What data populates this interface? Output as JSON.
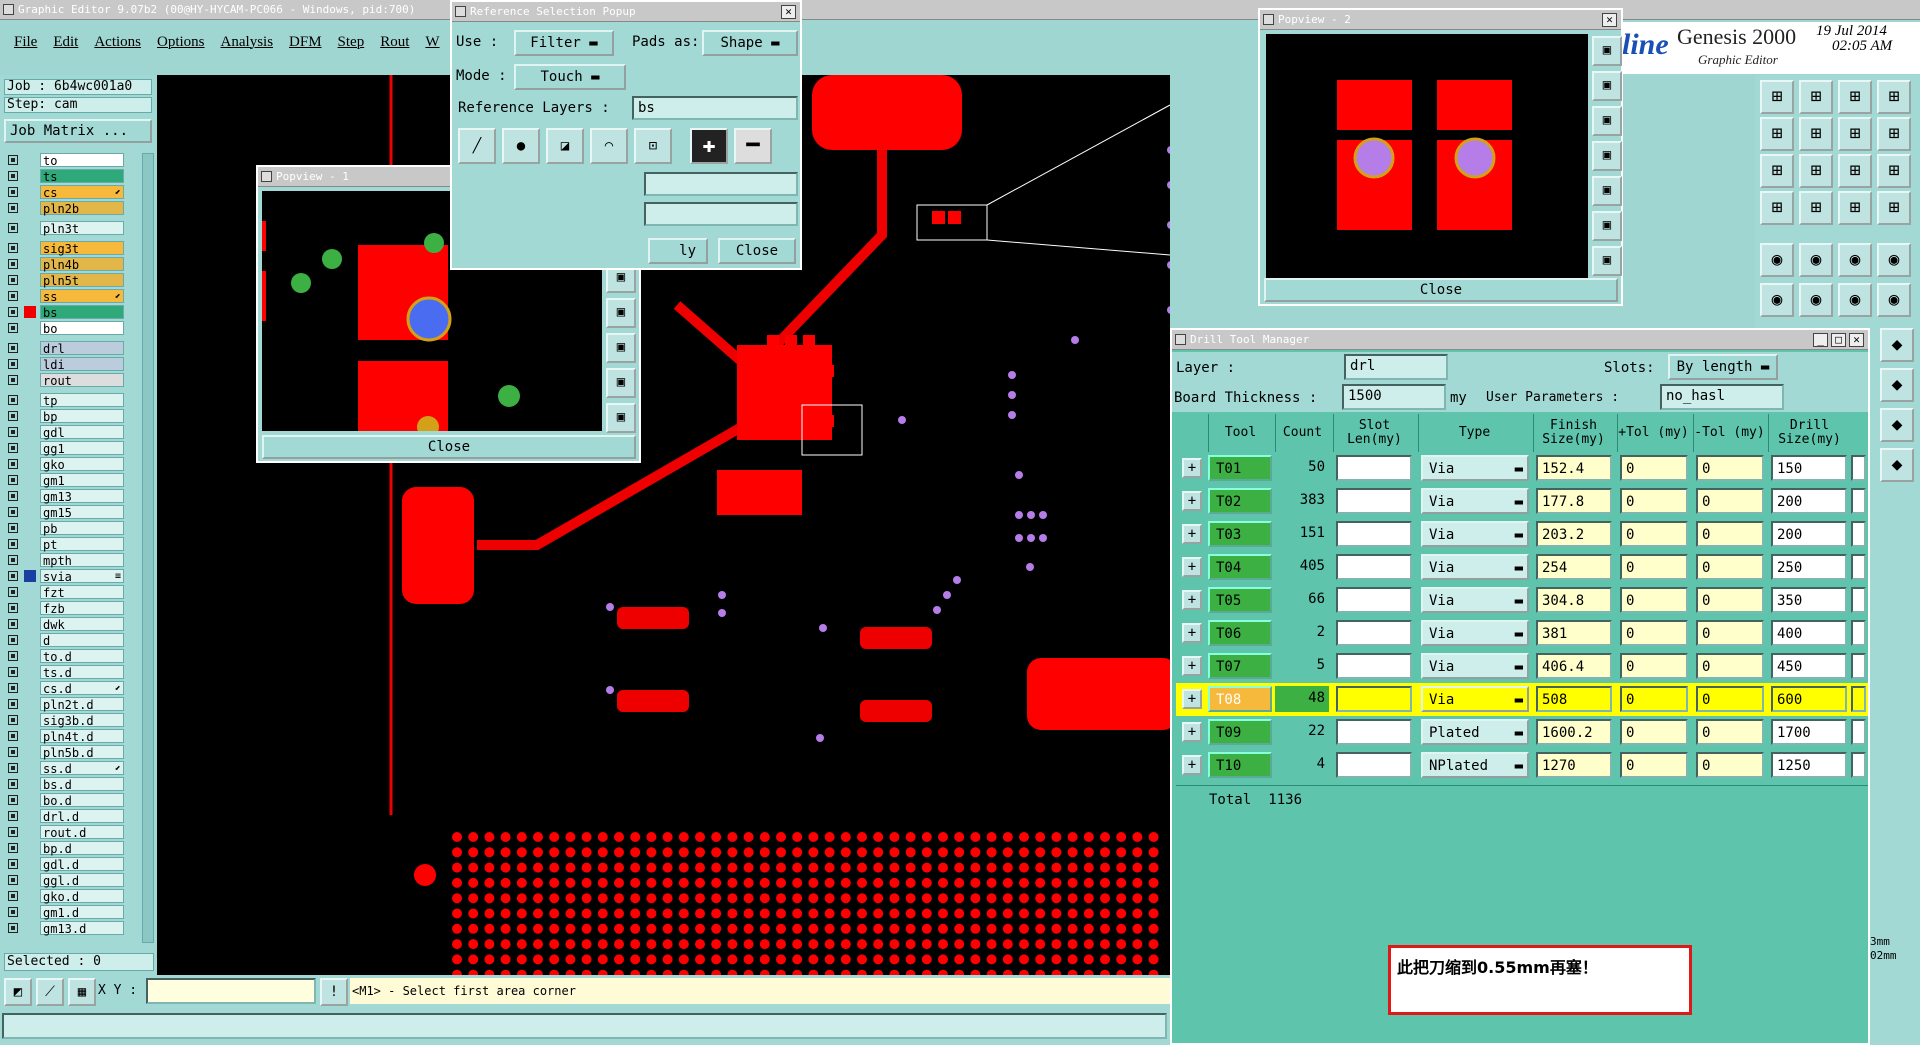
{
  "app": {
    "title": "Graphic Editor 9.07b2 (00@HY-HYCAM-PC066 - Windows, pid:700)",
    "brand_partial": "line",
    "brand": "Genesis 2000",
    "subtitle": "Graphic Editor",
    "date": "19 Jul 2014",
    "time": "02:05 AM"
  },
  "menu": [
    "File",
    "Edit",
    "Actions",
    "Options",
    "Analysis",
    "DFM",
    "Step",
    "Rout",
    "W"
  ],
  "job": {
    "job_label": "Job : 6b4wc001a0",
    "step_label": "Step: cam",
    "matrix_btn": "Job Matrix ..."
  },
  "layers": [
    {
      "name": "to",
      "color": "#ffffff",
      "mark": ""
    },
    {
      "name": "ts",
      "color": "#2fa87a",
      "mark": ""
    },
    {
      "name": "cs",
      "color": "#f6b93b",
      "mark": "⬋"
    },
    {
      "name": "pln2b",
      "color": "#e3b64a",
      "mark": ""
    },
    {
      "name": "pln3t",
      "color": "#ddf3f0",
      "mark": ""
    },
    {
      "name": "sig3t",
      "color": "#f6b93b",
      "mark": ""
    },
    {
      "name": "pln4b",
      "color": "#e3b64a",
      "mark": ""
    },
    {
      "name": "pln5t",
      "color": "#e3b64a",
      "mark": ""
    },
    {
      "name": "ss",
      "color": "#f6b93b",
      "mark": "⬋"
    },
    {
      "name": "bs",
      "color": "#2fa87a",
      "mark": ""
    },
    {
      "name": "bo",
      "color": "#ffffff",
      "mark": ""
    },
    {
      "name": "drl",
      "color": "#bcd",
      "mark": ""
    },
    {
      "name": "ldi",
      "color": "#bcd",
      "mark": ""
    },
    {
      "name": "rout",
      "color": "#ddd",
      "mark": ""
    },
    {
      "name": "tp",
      "color": "#ddf3f0",
      "mark": ""
    },
    {
      "name": "bp",
      "color": "#ddf3f0",
      "mark": ""
    },
    {
      "name": "gdl",
      "color": "#ddf3f0",
      "mark": ""
    },
    {
      "name": "gg1",
      "color": "#ddf3f0",
      "mark": ""
    },
    {
      "name": "gko",
      "color": "#ddf3f0",
      "mark": ""
    },
    {
      "name": "gm1",
      "color": "#ddf3f0",
      "mark": ""
    },
    {
      "name": "gm13",
      "color": "#ddf3f0",
      "mark": ""
    },
    {
      "name": "gm15",
      "color": "#ddf3f0",
      "mark": ""
    },
    {
      "name": "pb",
      "color": "#ddf3f0",
      "mark": ""
    },
    {
      "name": "pt",
      "color": "#ddf3f0",
      "mark": ""
    },
    {
      "name": "mpth",
      "color": "#ddf3f0",
      "mark": ""
    },
    {
      "name": "svia",
      "color": "#ddf3f0",
      "mark": "≡"
    },
    {
      "name": "fzt",
      "color": "#ddf3f0",
      "mark": ""
    },
    {
      "name": "fzb",
      "color": "#ddf3f0",
      "mark": ""
    },
    {
      "name": "dwk",
      "color": "#ddf3f0",
      "mark": ""
    },
    {
      "name": "d",
      "color": "#ddf3f0",
      "mark": ""
    },
    {
      "name": "to.d",
      "color": "#ddf3f0",
      "mark": ""
    },
    {
      "name": "ts.d",
      "color": "#ddf3f0",
      "mark": ""
    },
    {
      "name": "cs.d",
      "color": "#ddf3f0",
      "mark": "⬋"
    },
    {
      "name": "pln2t.d",
      "color": "#ddf3f0",
      "mark": ""
    },
    {
      "name": "sig3b.d",
      "color": "#ddf3f0",
      "mark": ""
    },
    {
      "name": "pln4t.d",
      "color": "#ddf3f0",
      "mark": ""
    },
    {
      "name": "pln5b.d",
      "color": "#ddf3f0",
      "mark": ""
    },
    {
      "name": "ss.d",
      "color": "#ddf3f0",
      "mark": "⬋"
    },
    {
      "name": "bs.d",
      "color": "#ddf3f0",
      "mark": ""
    },
    {
      "name": "bo.d",
      "color": "#ddf3f0",
      "mark": ""
    },
    {
      "name": "drl.d",
      "color": "#ddf3f0",
      "mark": ""
    },
    {
      "name": "rout.d",
      "color": "#ddf3f0",
      "mark": ""
    },
    {
      "name": "bp.d",
      "color": "#ddf3f0",
      "mark": ""
    },
    {
      "name": "gdl.d",
      "color": "#ddf3f0",
      "mark": ""
    },
    {
      "name": "ggl.d",
      "color": "#ddf3f0",
      "mark": ""
    },
    {
      "name": "gko.d",
      "color": "#ddf3f0",
      "mark": ""
    },
    {
      "name": "gm1.d",
      "color": "#ddf3f0",
      "mark": ""
    },
    {
      "name": "gm13.d",
      "color": "#ddf3f0",
      "mark": ""
    }
  ],
  "status": {
    "selected": "Selected : 0",
    "xy_label": "X Y :",
    "xy_value": "",
    "prompt": "<M1> - Select first area corner"
  },
  "ref_popup": {
    "title": "Reference Selection Popup",
    "use_label": "Use :",
    "use_value": "Filter",
    "pads_label": "Pads as:",
    "pads_value": "Shape",
    "mode_label": "Mode :",
    "mode_value": "Touch",
    "ref_layers_label": "Reference Layers :",
    "ref_layers_value": "bs",
    "apply_partial": "ly",
    "close": "Close"
  },
  "popview1": {
    "title": "Popview - 1",
    "close": "Close"
  },
  "popview2": {
    "title": "Popview - 2",
    "close": "Close"
  },
  "drill": {
    "title": "Drill Tool Manager",
    "layer_label": "Layer :",
    "layer_value": "drl",
    "slots_label": "Slots:",
    "slots_value": "By length",
    "thick_label": "Board Thickness :",
    "thick_value": "1500",
    "thick_unit": "my",
    "user_params_label": "User Parameters :",
    "user_params_value": "no_hasl",
    "headers": [
      "Tool",
      "Count",
      "Slot Len(my)",
      "Type",
      "Finish Size(my)",
      "+Tol (my)",
      "-Tol (my)",
      "Drill Size(my)"
    ],
    "rows": [
      {
        "tool": "T01",
        "count": "50",
        "type": "Via",
        "finish": "152.4",
        "ptol": "0",
        "mtol": "0",
        "drill": "150"
      },
      {
        "tool": "T02",
        "count": "383",
        "type": "Via",
        "finish": "177.8",
        "ptol": "0",
        "mtol": "0",
        "drill": "200"
      },
      {
        "tool": "T03",
        "count": "151",
        "type": "Via",
        "finish": "203.2",
        "ptol": "0",
        "mtol": "0",
        "drill": "200"
      },
      {
        "tool": "T04",
        "count": "405",
        "type": "Via",
        "finish": "254",
        "ptol": "0",
        "mtol": "0",
        "drill": "250"
      },
      {
        "tool": "T05",
        "count": "66",
        "type": "Via",
        "finish": "304.8",
        "ptol": "0",
        "mtol": "0",
        "drill": "350"
      },
      {
        "tool": "T06",
        "count": "2",
        "type": "Via",
        "finish": "381",
        "ptol": "0",
        "mtol": "0",
        "drill": "400"
      },
      {
        "tool": "T07",
        "count": "5",
        "type": "Via",
        "finish": "406.4",
        "ptol": "0",
        "mtol": "0",
        "drill": "450"
      },
      {
        "tool": "T08",
        "count": "48",
        "type": "Via",
        "finish": "508",
        "ptol": "0",
        "mtol": "0",
        "drill": "600"
      },
      {
        "tool": "T09",
        "count": "22",
        "type": "Plated",
        "finish": "1600.2",
        "ptol": "0",
        "mtol": "0",
        "drill": "1700"
      },
      {
        "tool": "T10",
        "count": "4",
        "type": "NPlated",
        "finish": "1270",
        "ptol": "0",
        "mtol": "0",
        "drill": "1250"
      }
    ],
    "total_label": "Total",
    "total_count": "1136"
  },
  "note": "此把刀缩到0.55mm再塞！",
  "right_partial": [
    "3mm",
    "02mm"
  ],
  "colors": {
    "teal": "#a3d9d5",
    "red": "#ff0000",
    "highlight": "#ffff00",
    "green": "#3cb043"
  }
}
